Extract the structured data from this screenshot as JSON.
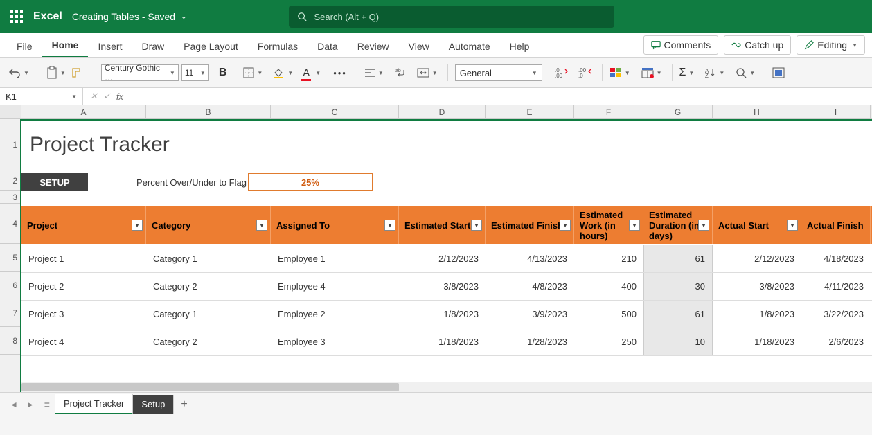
{
  "app": {
    "name": "Excel",
    "doc": "Creating Tables",
    "status": "- Saved"
  },
  "search": {
    "placeholder": "Search (Alt + Q)"
  },
  "tabs": [
    "File",
    "Home",
    "Insert",
    "Draw",
    "Page Layout",
    "Formulas",
    "Data",
    "Review",
    "View",
    "Automate",
    "Help"
  ],
  "activeTab": "Home",
  "ribbonButtons": {
    "comments": "Comments",
    "catchup": "Catch up",
    "editing": "Editing"
  },
  "toolbar": {
    "font": "Century Gothic …",
    "size": "11",
    "numberFormat": "General"
  },
  "nameBox": "K1",
  "columns": [
    "A",
    "B",
    "C",
    "D",
    "E",
    "F",
    "G",
    "H",
    "I"
  ],
  "sheet": {
    "title": "Project Tracker",
    "setup": "SETUP",
    "flagLabel": "Percent Over/Under to Flag",
    "flagValue": "25%"
  },
  "headers": [
    "Project",
    "Category",
    "Assigned To",
    "Estimated Start",
    "Estimated Finish",
    "Estimated Work (in hours)",
    "Estimated Duration (in days)",
    "Actual Start",
    "Actual Finish"
  ],
  "rows": [
    {
      "project": "Project 1",
      "category": "Category 1",
      "assigned": "Employee 1",
      "estStart": "2/12/2023",
      "estFinish": "4/13/2023",
      "work": "210",
      "dur": "61",
      "actStart": "2/12/2023",
      "actFinish": "4/18/2023"
    },
    {
      "project": "Project 2",
      "category": "Category 2",
      "assigned": "Employee 4",
      "estStart": "3/8/2023",
      "estFinish": "4/8/2023",
      "work": "400",
      "dur": "30",
      "actStart": "3/8/2023",
      "actFinish": "4/11/2023"
    },
    {
      "project": "Project 3",
      "category": "Category 1",
      "assigned": "Employee 2",
      "estStart": "1/8/2023",
      "estFinish": "3/9/2023",
      "work": "500",
      "dur": "61",
      "actStart": "1/8/2023",
      "actFinish": "3/22/2023"
    },
    {
      "project": "Project 4",
      "category": "Category 2",
      "assigned": "Employee 3",
      "estStart": "1/18/2023",
      "estFinish": "1/28/2023",
      "work": "250",
      "dur": "10",
      "actStart": "1/18/2023",
      "actFinish": "2/6/2023"
    }
  ],
  "sheetTabs": {
    "active": "Project Tracker",
    "other": "Setup"
  }
}
